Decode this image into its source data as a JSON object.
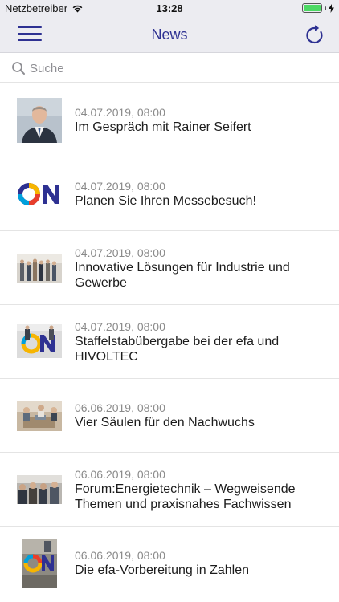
{
  "status_bar": {
    "carrier": "Netzbetreiber",
    "time": "13:28"
  },
  "nav": {
    "title": "News"
  },
  "search": {
    "placeholder": "Suche"
  },
  "news": [
    {
      "date": "04.07.2019, 08:00",
      "title": "Im Gespräch mit Rainer Seifert",
      "thumb": "portrait-photo"
    },
    {
      "date": "04.07.2019, 08:00",
      "title": "Planen Sie Ihren Messebesuch!",
      "thumb": "on-logo"
    },
    {
      "date": "04.07.2019, 08:00",
      "title": "Innovative Lösungen für Industrie und Gewerbe",
      "thumb": "exhibition-crowd-photo"
    },
    {
      "date": "04.07.2019, 08:00",
      "title": "Staffelstabübergabe bei der efa und HIVOLTEC",
      "thumb": "handover-photo"
    },
    {
      "date": "06.06.2019, 08:00",
      "title": "Vier Säulen für den Nachwuchs",
      "thumb": "workshop-photo"
    },
    {
      "date": "06.06.2019, 08:00",
      "title": "Forum:Energietechnik – Wegweisende Themen und praxisnahes Fachwissen",
      "thumb": "audience-photo"
    },
    {
      "date": "06.06.2019, 08:00",
      "title": "Die efa-Vorbereitung in Zahlen",
      "thumb": "on-logo-photo"
    }
  ],
  "colors": {
    "accent": "#2e3192",
    "bar_background": "#ececf1",
    "battery": "#4cd964",
    "separator": "#e4e4e4"
  }
}
